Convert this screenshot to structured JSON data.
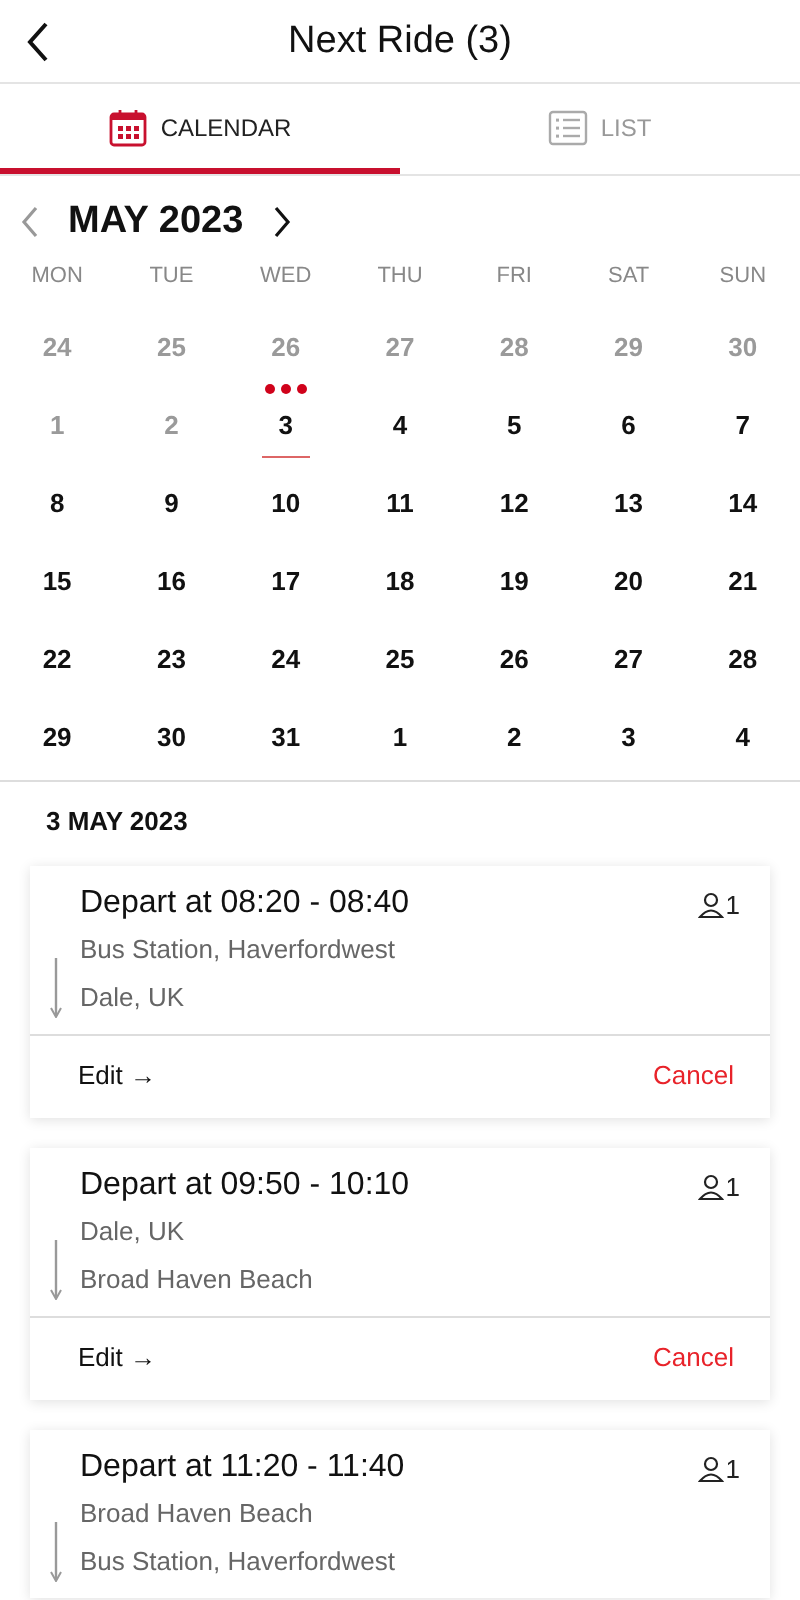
{
  "header": {
    "title": "Next Ride (3)"
  },
  "tabs": [
    {
      "label": "CALENDAR",
      "kind": "calendar",
      "selected": true
    },
    {
      "label": "LIST",
      "kind": "list",
      "selected": false
    }
  ],
  "calendar": {
    "month": "MAY 2023",
    "weekdays": [
      "MON",
      "TUE",
      "WED",
      "THU",
      "FRI",
      "SAT",
      "SUN"
    ],
    "weeks": [
      [
        {
          "day": "24",
          "muted": true,
          "selected": false,
          "has_rides": false
        },
        {
          "day": "25",
          "muted": true,
          "selected": false,
          "has_rides": false
        },
        {
          "day": "26",
          "muted": true,
          "selected": false,
          "has_rides": false
        },
        {
          "day": "27",
          "muted": true,
          "selected": false,
          "has_rides": false
        },
        {
          "day": "28",
          "muted": true,
          "selected": false,
          "has_rides": false
        },
        {
          "day": "29",
          "muted": true,
          "selected": false,
          "has_rides": false
        },
        {
          "day": "30",
          "muted": true,
          "selected": false,
          "has_rides": false
        }
      ],
      [
        {
          "day": "1",
          "muted": true,
          "selected": false,
          "has_rides": false
        },
        {
          "day": "2",
          "muted": true,
          "selected": false,
          "has_rides": false
        },
        {
          "day": "3",
          "muted": false,
          "selected": true,
          "has_rides": true
        },
        {
          "day": "4",
          "muted": false,
          "selected": false,
          "has_rides": false
        },
        {
          "day": "5",
          "muted": false,
          "selected": false,
          "has_rides": false
        },
        {
          "day": "6",
          "muted": false,
          "selected": false,
          "has_rides": false
        },
        {
          "day": "7",
          "muted": false,
          "selected": false,
          "has_rides": false
        }
      ],
      [
        {
          "day": "8",
          "muted": false,
          "selected": false,
          "has_rides": false
        },
        {
          "day": "9",
          "muted": false,
          "selected": false,
          "has_rides": false
        },
        {
          "day": "10",
          "muted": false,
          "selected": false,
          "has_rides": false
        },
        {
          "day": "11",
          "muted": false,
          "selected": false,
          "has_rides": false
        },
        {
          "day": "12",
          "muted": false,
          "selected": false,
          "has_rides": false
        },
        {
          "day": "13",
          "muted": false,
          "selected": false,
          "has_rides": false
        },
        {
          "day": "14",
          "muted": false,
          "selected": false,
          "has_rides": false
        }
      ],
      [
        {
          "day": "15",
          "muted": false,
          "selected": false,
          "has_rides": false
        },
        {
          "day": "16",
          "muted": false,
          "selected": false,
          "has_rides": false
        },
        {
          "day": "17",
          "muted": false,
          "selected": false,
          "has_rides": false
        },
        {
          "day": "18",
          "muted": false,
          "selected": false,
          "has_rides": false
        },
        {
          "day": "19",
          "muted": false,
          "selected": false,
          "has_rides": false
        },
        {
          "day": "20",
          "muted": false,
          "selected": false,
          "has_rides": false
        },
        {
          "day": "21",
          "muted": false,
          "selected": false,
          "has_rides": false
        }
      ],
      [
        {
          "day": "22",
          "muted": false,
          "selected": false,
          "has_rides": false
        },
        {
          "day": "23",
          "muted": false,
          "selected": false,
          "has_rides": false
        },
        {
          "day": "24",
          "muted": false,
          "selected": false,
          "has_rides": false
        },
        {
          "day": "25",
          "muted": false,
          "selected": false,
          "has_rides": false
        },
        {
          "day": "26",
          "muted": false,
          "selected": false,
          "has_rides": false
        },
        {
          "day": "27",
          "muted": false,
          "selected": false,
          "has_rides": false
        },
        {
          "day": "28",
          "muted": false,
          "selected": false,
          "has_rides": false
        }
      ],
      [
        {
          "day": "29",
          "muted": false,
          "selected": false,
          "has_rides": false
        },
        {
          "day": "30",
          "muted": false,
          "selected": false,
          "has_rides": false
        },
        {
          "day": "31",
          "muted": false,
          "selected": false,
          "has_rides": false
        },
        {
          "day": "1",
          "muted": false,
          "selected": false,
          "has_rides": false
        },
        {
          "day": "2",
          "muted": false,
          "selected": false,
          "has_rides": false
        },
        {
          "day": "3",
          "muted": false,
          "selected": false,
          "has_rides": false
        },
        {
          "day": "4",
          "muted": false,
          "selected": false,
          "has_rides": false
        }
      ]
    ]
  },
  "date_heading": "3 MAY 2023",
  "rides": [
    {
      "title": "Depart at 08:20 - 08:40",
      "passengers": "1",
      "from": "Bus Station, Haverfordwest",
      "to": "Dale, UK",
      "edit": "Edit →",
      "cancel": "Cancel"
    },
    {
      "title": "Depart at 09:50 - 10:10",
      "passengers": "1",
      "from": "Dale, UK",
      "to": "Broad Haven Beach",
      "edit": "Edit →",
      "cancel": "Cancel"
    },
    {
      "title": "Depart at 11:20 - 11:40",
      "passengers": "1",
      "from": "Broad Haven Beach",
      "to": "Bus Station, Haverfordwest"
    }
  ]
}
